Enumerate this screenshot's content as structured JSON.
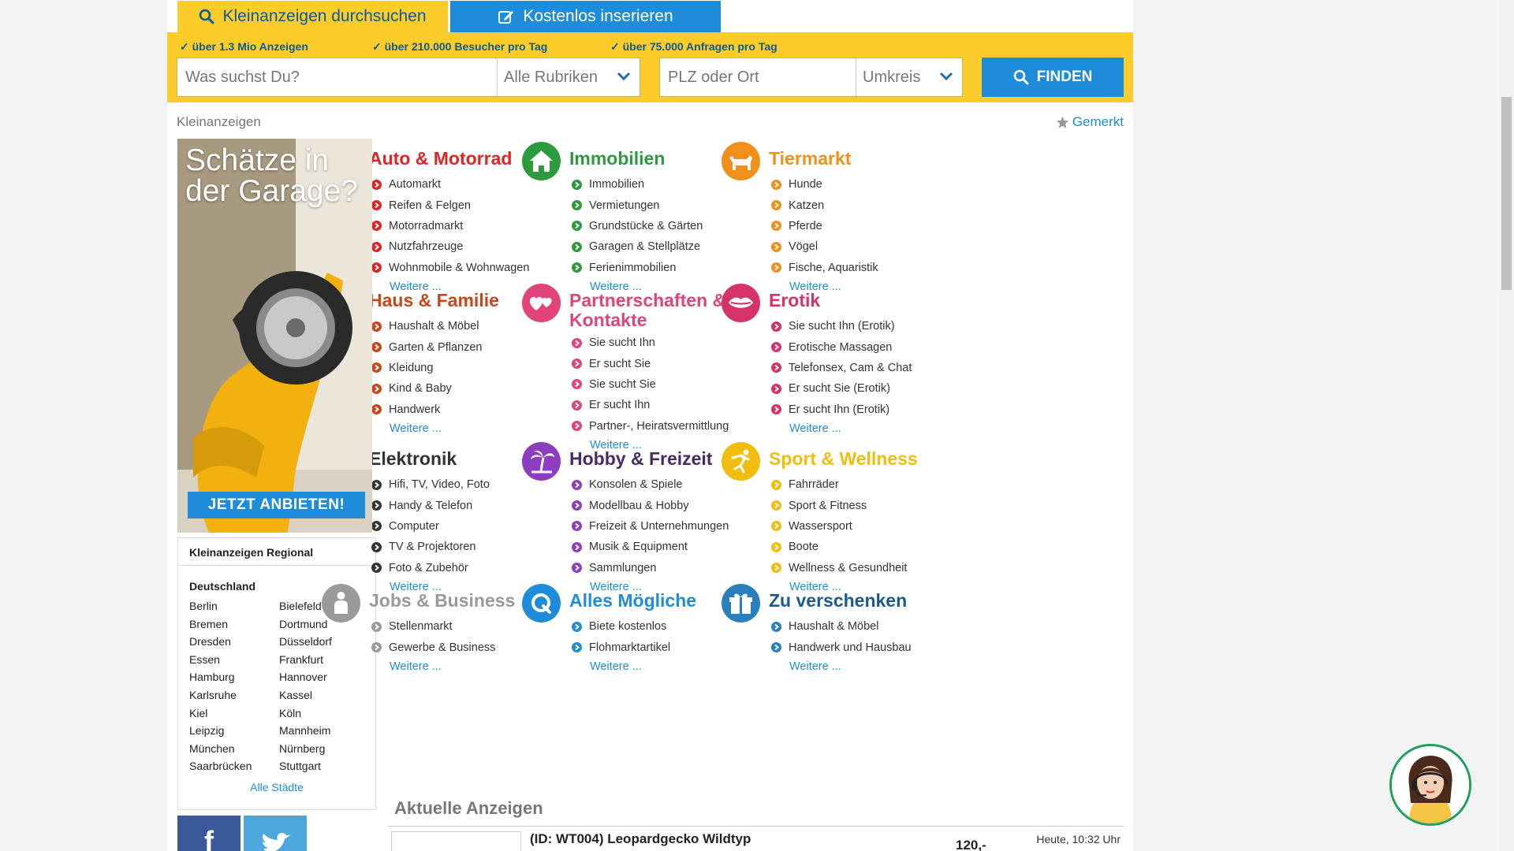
{
  "tabs": {
    "search": "Kleinanzeigen durchsuchen",
    "post": "Kostenlos inserieren"
  },
  "usps": [
    "über 1.3 Mio Anzeigen",
    "über 210.000 Besucher pro Tag",
    "über 75.000 Anfragen pro Tag"
  ],
  "search": {
    "query_placeholder": "Was suchst Du?",
    "category_select": "Alle Rubriken",
    "location_placeholder": "PLZ oder Ort",
    "radius_select": "Umkreis",
    "find_label": "FINDEN"
  },
  "breadcrumb": "Kleinanzeigen",
  "bookmarked": "Gemerkt",
  "ad": {
    "title": "Schätze in der Garage?",
    "button": "JETZT ANBIETEN!"
  },
  "regional": {
    "title": "Kleinanzeigen Regional",
    "country": "Deutschland",
    "cities": [
      "Berlin",
      "Bielefeld",
      "Bremen",
      "Dortmund",
      "Dresden",
      "Düsseldorf",
      "Essen",
      "Frankfurt",
      "Hamburg",
      "Hannover",
      "Karlsruhe",
      "Kassel",
      "Kiel",
      "Köln",
      "Leipzig",
      "Mannheim",
      "München",
      "Nürnberg",
      "Saarbrücken",
      "Stuttgart"
    ],
    "all_cities": "Alle Städte"
  },
  "more_label": "Weitere ...",
  "categories": [
    {
      "title": "Auto & Motorrad",
      "color": "#e02424",
      "icon": "car-icon",
      "items": [
        "Automarkt",
        "Reifen & Felgen",
        "Motorradmarkt",
        "Nutzfahrzeuge",
        "Wohnmobile & Wohnwagen"
      ]
    },
    {
      "title": "Immobilien",
      "color": "#2e9a3e",
      "icon": "house-icon",
      "items": [
        "Immobilien",
        "Vermietungen",
        "Grundstücke & Gärten",
        "Garagen & Stellplätze",
        "Ferienimmobilien"
      ]
    },
    {
      "title": "Tiermarkt",
      "color": "#f0901a",
      "icon": "dog-icon",
      "items": [
        "Hunde",
        "Katzen",
        "Pferde",
        "Vögel",
        "Fische, Aquaristik"
      ]
    },
    {
      "title": "Haus & Familie",
      "color": "#c8471a",
      "icon": "sofa-icon",
      "items": [
        "Haushalt & Möbel",
        "Garten & Pflanzen",
        "Kleidung",
        "Kind & Baby",
        "Handwerk"
      ]
    },
    {
      "title": "Partnerschaften & Kontakte",
      "color": "#e0447a",
      "icon": "hearts-icon",
      "items": [
        "Sie sucht Ihn",
        "Er sucht Sie",
        "Sie sucht Sie",
        "Er sucht Ihn",
        "Partner-, Heiratsvermittlung"
      ]
    },
    {
      "title": "Erotik",
      "color": "#d6326a",
      "icon": "lips-icon",
      "items": [
        "Sie sucht Ihn (Erotik)",
        "Erotische Massagen",
        "Telefonsex, Cam & Chat",
        "Er sucht Sie (Erotik)",
        "Er sucht Ihn (Erotik)"
      ]
    },
    {
      "title": "Elektronik",
      "color": "#333333",
      "icon": "tv-icon",
      "items": [
        "Hifi, TV, Video, Foto",
        "Handy & Telefon",
        "Computer",
        "TV & Projektoren",
        "Foto & Zubehör"
      ]
    },
    {
      "title": "Hobby & Freizeit",
      "color": "#4a2a66",
      "icon": "palm-icon",
      "icon_color": "#8d3dbf",
      "items": [
        "Konsolen & Spiele",
        "Modellbau & Hobby",
        "Freizeit & Unternehmungen",
        "Musik & Equipment",
        "Sammlungen"
      ]
    },
    {
      "title": "Sport & Wellness",
      "color": "#f2bd0f",
      "icon": "sport-icon",
      "items": [
        "Fahrräder",
        "Sport & Fitness",
        "Wassersport",
        "Boote",
        "Wellness & Gesundheit"
      ]
    },
    {
      "title": "Jobs & Business",
      "color": "#9a9a9a",
      "icon": "person-icon",
      "items": [
        "Stellenmarkt",
        "Gewerbe & Business"
      ]
    },
    {
      "title": "Alles Mögliche",
      "color": "#1f8cd9",
      "icon": "q-icon",
      "items": [
        "Biete kostenlos",
        "Flohmarktartikel"
      ]
    },
    {
      "title": "Zu verschenken",
      "color": "#1a5a8f",
      "icon": "gift-icon",
      "icon_color": "#2a7fbf",
      "items": [
        "Haushalt & Möbel",
        "Handwerk und Hausbau"
      ]
    }
  ],
  "latest": {
    "title": "Aktuelle Anzeigen",
    "item_title": "(ID: WT004) Leopardgecko Wildtyp",
    "item_price": "120,-",
    "item_time": "Heute, 10:32 Uhr"
  },
  "colors": {
    "brand_yellow": "#fccd2a",
    "brand_blue": "#1f8cd9",
    "link_blue": "#1f8cd9"
  }
}
